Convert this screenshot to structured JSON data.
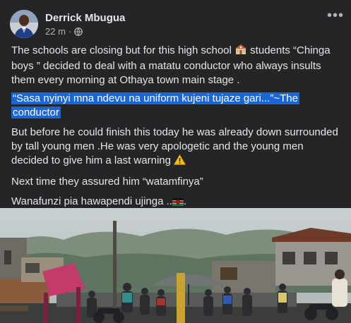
{
  "post": {
    "author": "Derrick Mbugua",
    "time": "22 m",
    "separator": "·",
    "privacy_icon": "globe-icon",
    "more_icon": "more-options-icon",
    "more_label": "•••",
    "paragraphs": {
      "p1_before": "The schools are closing but for this high school ",
      "p1_emoji": "school-emoji",
      "p1_after": " students “Chinga boys ” decided to deal with a matatu conductor who always insults them every morning at Othaya town main stage .",
      "p2_highlighted": "“Sasa nyinyi mna ndevu na uniform kujeni tujaze gari...”~The conductor",
      "p3_before": "But before he could finish this today he was already down surrounded by tall young men .He was very apologetic and the young men decided to give him a last warning ",
      "p3_emoji": "warning-emoji",
      "p4": "Next time they assured him “watamfinya”",
      "p5_before": "Wanafunzi pia hawapendi ujinga ..",
      "p5_emoji": "kenya-flag-emoji",
      "p5_after": "."
    },
    "photo": {
      "description_icon": "street-photo"
    },
    "colors": {
      "background": "#242526",
      "text": "#e4e6eb",
      "secondary_text": "#b0b3b8",
      "highlight": "#1a66d6"
    }
  }
}
